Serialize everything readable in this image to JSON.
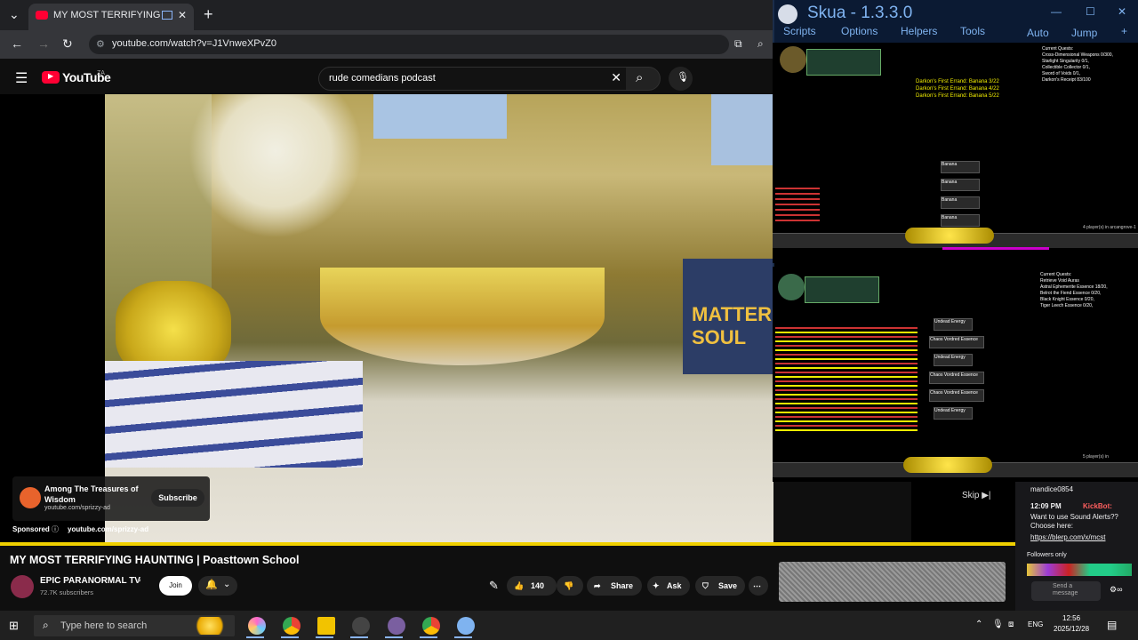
{
  "browser": {
    "tab_title": "MY MOST TERRIFYING HAU",
    "url": "youtube.com/watch?v=J1VnweXPvZ0"
  },
  "youtube": {
    "logo_text": "YouTube",
    "country_code": "ZA",
    "search_query": "rude comedians podcast",
    "video_title": "MY MOST TERRIFYING HAUNTING | Poasttown School",
    "channel_name": "EPIC PARANORMAL TV",
    "subscribers": "72.7K subscribers",
    "join_label": "Join",
    "like_count": "140",
    "share_label": "Share",
    "ask_label": "Ask",
    "save_label": "Save",
    "ad": {
      "title": "Among The Treasures of Wisdom",
      "url": "youtube.com/sprizzy-ad",
      "subscribe_label": "Subscribe",
      "sponsored_label": "Sponsored",
      "sponsored_url": "youtube.com/sprizzy-ad",
      "skip_label": "Skip"
    },
    "poster_text": "MATTER SOUL"
  },
  "skua": {
    "title": "Skua - 1.3.3.0",
    "menu": [
      "Scripts",
      "Options",
      "Helpers",
      "Tools"
    ],
    "right_menu": [
      "Auto",
      "Jump"
    ],
    "game1": {
      "quests_header": "Current Quests:",
      "quests": [
        "Cross-Dimensional Weapons 0/300,",
        "Starlight Singularity 0/1,",
        "Collectible Collector 0/1,",
        "Sword of Voids 0/1,",
        "Darkon's Receipt 83/100"
      ],
      "messages": [
        "Darkon's First Errand: Banana 3/22",
        "Darkon's First Errand: Banana 4/22",
        "Darkon's First Errand: Banana 5/22"
      ],
      "drops": [
        "Banana",
        "Banana",
        "Banana",
        "Banana"
      ],
      "players": "4 player(s) in arcangrove-1"
    },
    "game2": {
      "quests_header": "Current Quests:",
      "quests": [
        "Retrieve Void Auras",
        "Astral Ephemerite Essence 18/20,",
        "Belrot the Fiend Essence 0/20,",
        "Black Knight Essence 0/20,",
        "Tiger Leech Essence 0/20,"
      ],
      "drops": [
        "Undead Energy",
        "Chaos Vordred Essence",
        "Undead Energy",
        "Chaos Vordred Essence",
        "Chaos Vordred Essence",
        "Undead Energy"
      ],
      "players": "5 player(s) in"
    }
  },
  "chat": {
    "user": "mandice0854",
    "time": "12:09 PM",
    "bot": "KickBot:",
    "message": "Want to use Sound Alerts?? Choose here:",
    "link": "https://blerp.com/x/mcst",
    "followers_only": "Followers only",
    "send_placeholder": "Send a message"
  },
  "taskbar": {
    "search_placeholder": "Type here to search",
    "language": "ENG",
    "time": "12:56",
    "date": "2025/12/28"
  }
}
